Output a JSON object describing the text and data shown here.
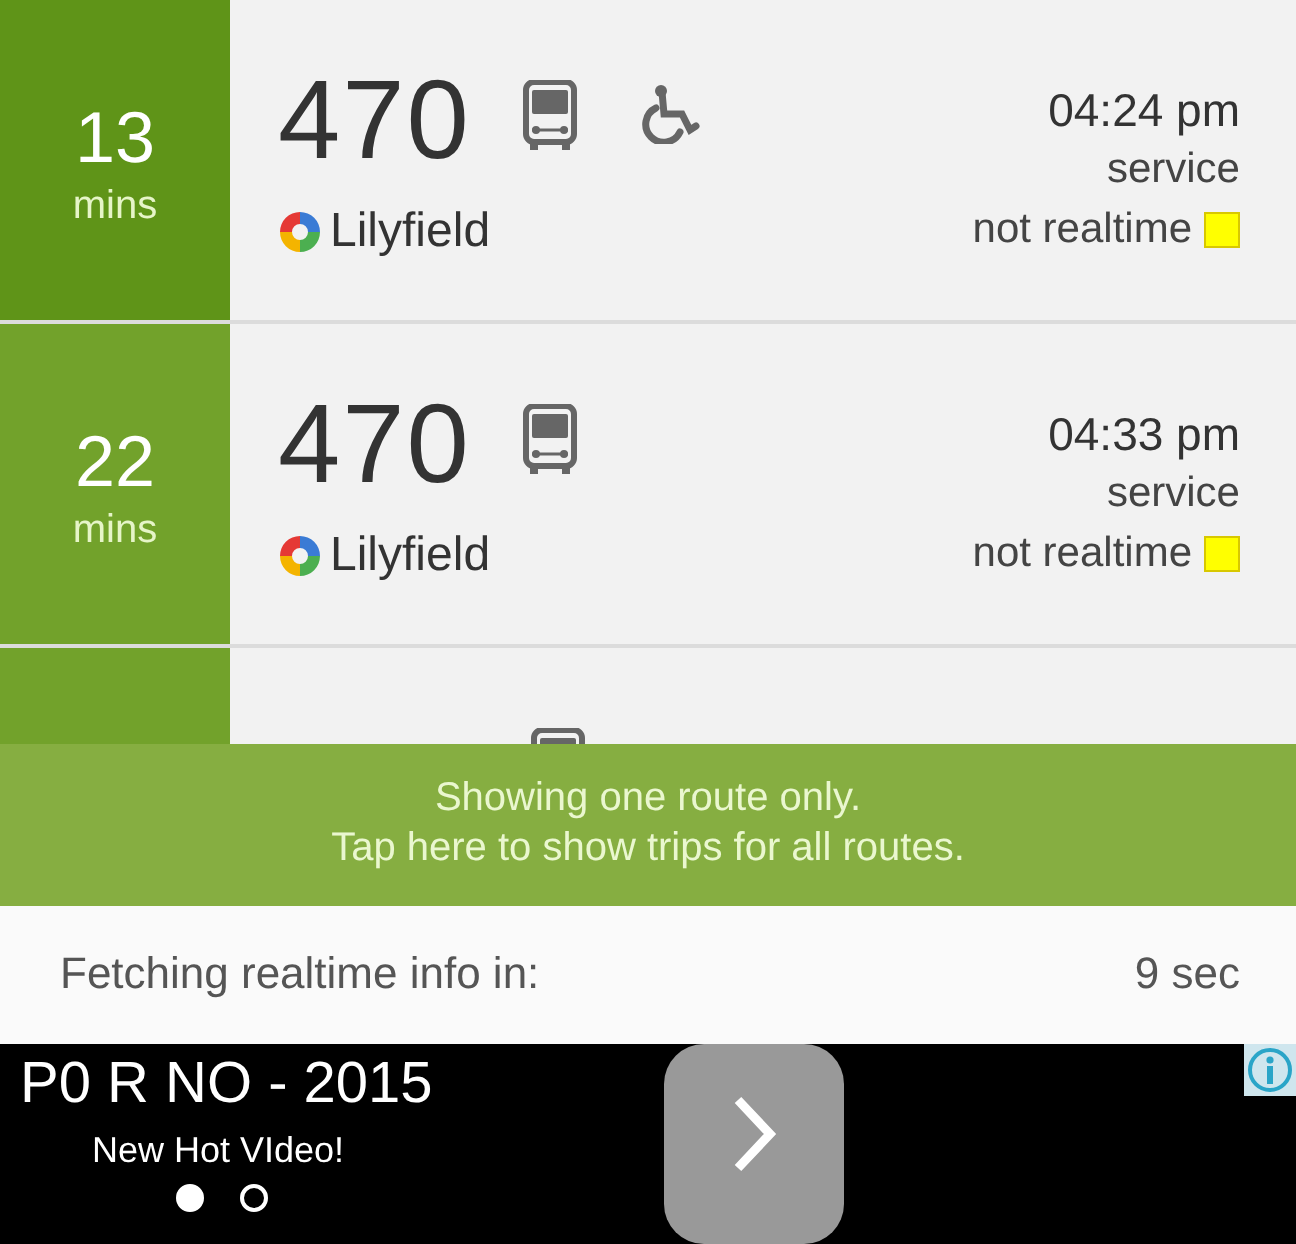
{
  "departures": [
    {
      "minutes": "13",
      "unit": "mins",
      "route": "470",
      "wheelchair": true,
      "destination": "Lilyfield",
      "time": "04:24 pm",
      "type": "service",
      "realtime_label": "not realtime",
      "realtime": false,
      "color": "#5f9418"
    },
    {
      "minutes": "22",
      "unit": "mins",
      "route": "470",
      "wheelchair": false,
      "destination": "Lilyfield",
      "time": "04:33 pm",
      "type": "service",
      "realtime_label": "not realtime",
      "realtime": false,
      "color": "#72a22b"
    },
    {
      "color": "#72a22b"
    }
  ],
  "banner": {
    "line_1": "Showing one route only.",
    "line_2": "Tap here to show trips for all routes."
  },
  "fetch": {
    "label": "Fetching realtime info in:",
    "value": "9 sec"
  },
  "ad": {
    "title": "P0 R NO - 2015",
    "subtitle": "New Hot VIdeo!",
    "dots": [
      {
        "selected": true
      },
      {
        "selected": false
      }
    ]
  }
}
